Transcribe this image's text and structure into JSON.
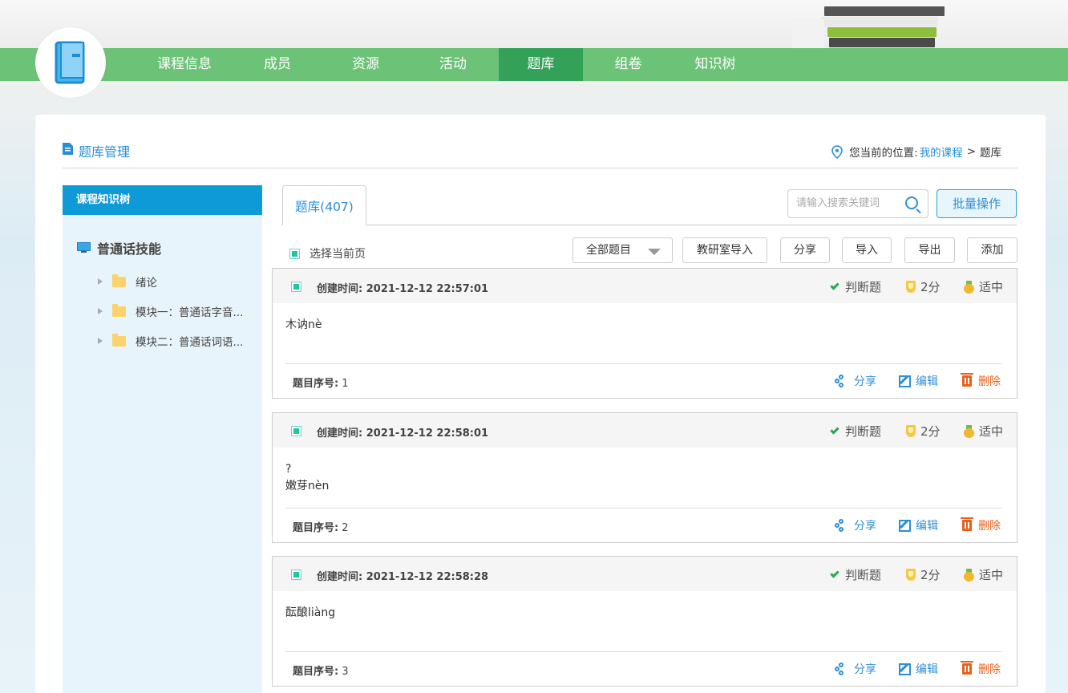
{
  "nav": {
    "items": [
      {
        "label": "课程信息",
        "active": false
      },
      {
        "label": "成员",
        "active": false
      },
      {
        "label": "资源",
        "active": false
      },
      {
        "label": "活动",
        "active": false
      },
      {
        "label": "题库",
        "active": true
      },
      {
        "label": "组卷",
        "active": false
      },
      {
        "label": "知识树",
        "active": false
      }
    ]
  },
  "colors": {
    "nav_bg": "#6cc277",
    "nav_active": "#34a159",
    "accent": "#2b8fd8",
    "sidebar_head": "#0d9ad6",
    "delete": "#e8601c"
  },
  "header": {
    "title": "题库管理",
    "location_label": "您当前的位置:",
    "location_link": "我的课程",
    "location_sep": ">",
    "location_current": "题库"
  },
  "sidebar": {
    "title": "课程知识树",
    "root": "普通话技能",
    "nodes": [
      "绪论",
      "模块一：普通话字音...",
      "模块二：普通话词语..."
    ]
  },
  "main": {
    "tab_label": "题库(407)",
    "search_placeholder": "请输入搜索关键词",
    "batch_label": "批量操作",
    "select_page_label": "选择当前页",
    "filter_label": "全部题目",
    "import_lab_label": "教研室导入",
    "share_label": "分享",
    "import_label": "导入",
    "export_label": "导出",
    "add_label": "添加"
  },
  "questions": [
    {
      "created_label": "创建时间:",
      "created": "2021-12-12 22:57:01",
      "type": "判断题",
      "score": "2分",
      "difficulty": "适中",
      "body_lines": [
        "木讷nè"
      ],
      "seq_label": "题目序号:",
      "seq": "1",
      "share": "分享",
      "edit": "编辑",
      "delete": "删除"
    },
    {
      "created_label": "创建时间:",
      "created": "2021-12-12 22:58:01",
      "type": "判断题",
      "score": "2分",
      "difficulty": "适中",
      "body_lines": [
        "?",
        "嫩芽nèn"
      ],
      "seq_label": "题目序号:",
      "seq": "2",
      "share": "分享",
      "edit": "编辑",
      "delete": "删除"
    },
    {
      "created_label": "创建时间:",
      "created": "2021-12-12 22:58:28",
      "type": "判断题",
      "score": "2分",
      "difficulty": "适中",
      "body_lines": [
        "酝酿liàng"
      ],
      "seq_label": "题目序号:",
      "seq": "3",
      "share": "分享",
      "edit": "编辑",
      "delete": "删除"
    }
  ]
}
